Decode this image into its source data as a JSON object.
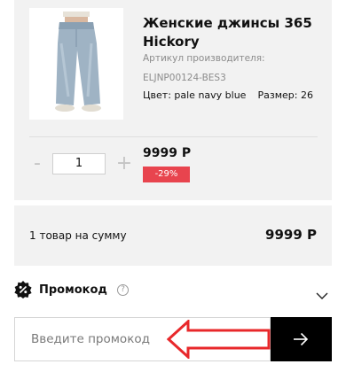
{
  "product": {
    "title": "Женские джинсы 365 Hickory",
    "sku_label": "Артикул производителя:",
    "sku": "ELJNP00124-BES3",
    "color": "Цвет: pale navy blue",
    "size": "Размер: 26",
    "image_icon": "jeans-image"
  },
  "quantity": {
    "minus_label": "-",
    "value": "1",
    "plus_label": "+"
  },
  "pricing": {
    "price": "9999 Р",
    "discount": "-29%",
    "discount_color": "#e8444e"
  },
  "summary": {
    "label": "1 товар на сумму",
    "total": "9999 Р"
  },
  "promo": {
    "title": "Промокод",
    "help_label": "?",
    "input_placeholder": "Введите промокод",
    "submit_icon": "arrow-right-icon",
    "annotation_color": "#e8282b"
  }
}
